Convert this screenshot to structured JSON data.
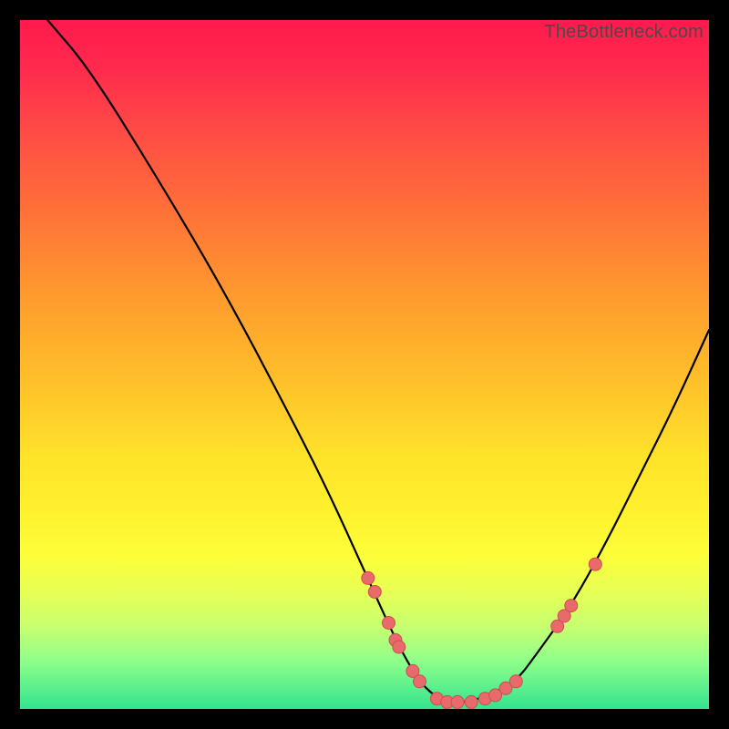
{
  "watermark": "TheBottleneck.com",
  "chart_data": {
    "type": "line",
    "title": "",
    "xlabel": "",
    "ylabel": "",
    "xlim": [
      0,
      100
    ],
    "ylim": [
      0,
      100
    ],
    "series": [
      {
        "name": "curve",
        "x": [
          4,
          10,
          20,
          30,
          40,
          45,
          50,
          55,
          58,
          60,
          62,
          65,
          68,
          72,
          75,
          80,
          85,
          90,
          95,
          100
        ],
        "y": [
          100,
          93,
          77,
          60,
          41,
          31,
          20,
          9,
          4,
          2,
          1,
          1,
          2,
          4,
          8,
          15,
          24,
          34,
          44,
          55
        ]
      }
    ],
    "annotations": {
      "dots": [
        {
          "x": 50.5,
          "y": 19.0
        },
        {
          "x": 51.5,
          "y": 17.0
        },
        {
          "x": 53.5,
          "y": 12.5
        },
        {
          "x": 54.5,
          "y": 10.0
        },
        {
          "x": 55.0,
          "y": 9.0
        },
        {
          "x": 57.0,
          "y": 5.5
        },
        {
          "x": 58.0,
          "y": 4.0
        },
        {
          "x": 60.5,
          "y": 1.5
        },
        {
          "x": 62.0,
          "y": 1.0
        },
        {
          "x": 63.5,
          "y": 1.0
        },
        {
          "x": 65.5,
          "y": 1.0
        },
        {
          "x": 67.5,
          "y": 1.5
        },
        {
          "x": 69.0,
          "y": 2.0
        },
        {
          "x": 70.5,
          "y": 3.0
        },
        {
          "x": 72.0,
          "y": 4.0
        },
        {
          "x": 78.0,
          "y": 12.0
        },
        {
          "x": 79.0,
          "y": 13.5
        },
        {
          "x": 80.0,
          "y": 15.0
        },
        {
          "x": 83.5,
          "y": 21.0
        }
      ]
    }
  }
}
